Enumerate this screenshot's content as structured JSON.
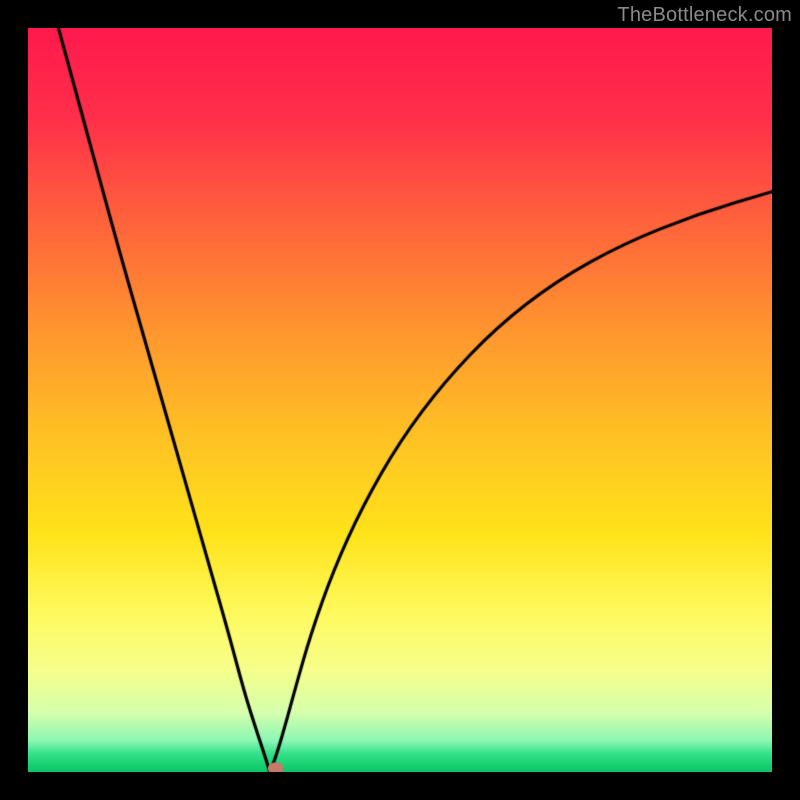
{
  "watermark": "TheBottleneck.com",
  "colors": {
    "frame": "#000000",
    "curve_stroke": "#000000",
    "marker_fill": "#c77a6a",
    "gradient_stops": [
      {
        "t": 0.0,
        "c": "#ff1a4d"
      },
      {
        "t": 0.12,
        "c": "#ff2f4a"
      },
      {
        "t": 0.28,
        "c": "#ff6a3a"
      },
      {
        "t": 0.42,
        "c": "#ff9a2e"
      },
      {
        "t": 0.55,
        "c": "#ffc224"
      },
      {
        "t": 0.68,
        "c": "#ffe31a"
      },
      {
        "t": 0.78,
        "c": "#fff95a"
      },
      {
        "t": 0.86,
        "c": "#f7ff8a"
      },
      {
        "t": 0.92,
        "c": "#d6ffad"
      },
      {
        "t": 0.958,
        "c": "#8cf7b4"
      },
      {
        "t": 0.975,
        "c": "#35e28a"
      },
      {
        "t": 1.0,
        "c": "#09c566"
      }
    ]
  },
  "chart_data": {
    "type": "line",
    "title": "",
    "xlabel": "",
    "ylabel": "",
    "xlim": [
      0,
      100
    ],
    "ylim": [
      0,
      100
    ],
    "note": "V-shaped bottleneck curve. y≈0 at the optimum, rising toward both ends; right branch saturates.",
    "optimum_x": 32.5,
    "marker": {
      "x": 33.3,
      "y": 0.5
    },
    "series": [
      {
        "name": "bottleneck",
        "x": [
          0,
          3,
          6,
          9,
          12,
          15,
          18,
          21,
          24,
          27,
          29,
          30.5,
          31.7,
          32.5,
          33.3,
          34.5,
          36,
          38,
          41,
          45,
          50,
          56,
          63,
          71,
          80,
          90,
          100
        ],
        "y": [
          115,
          104,
          93,
          82,
          71,
          60.5,
          50,
          39.5,
          29,
          18.5,
          11,
          6.2,
          2.6,
          0.0,
          2.0,
          6.0,
          11.5,
          18.5,
          27.0,
          35.8,
          44.5,
          52.5,
          59.8,
          66.0,
          71.0,
          75.0,
          78.0
        ]
      }
    ]
  }
}
